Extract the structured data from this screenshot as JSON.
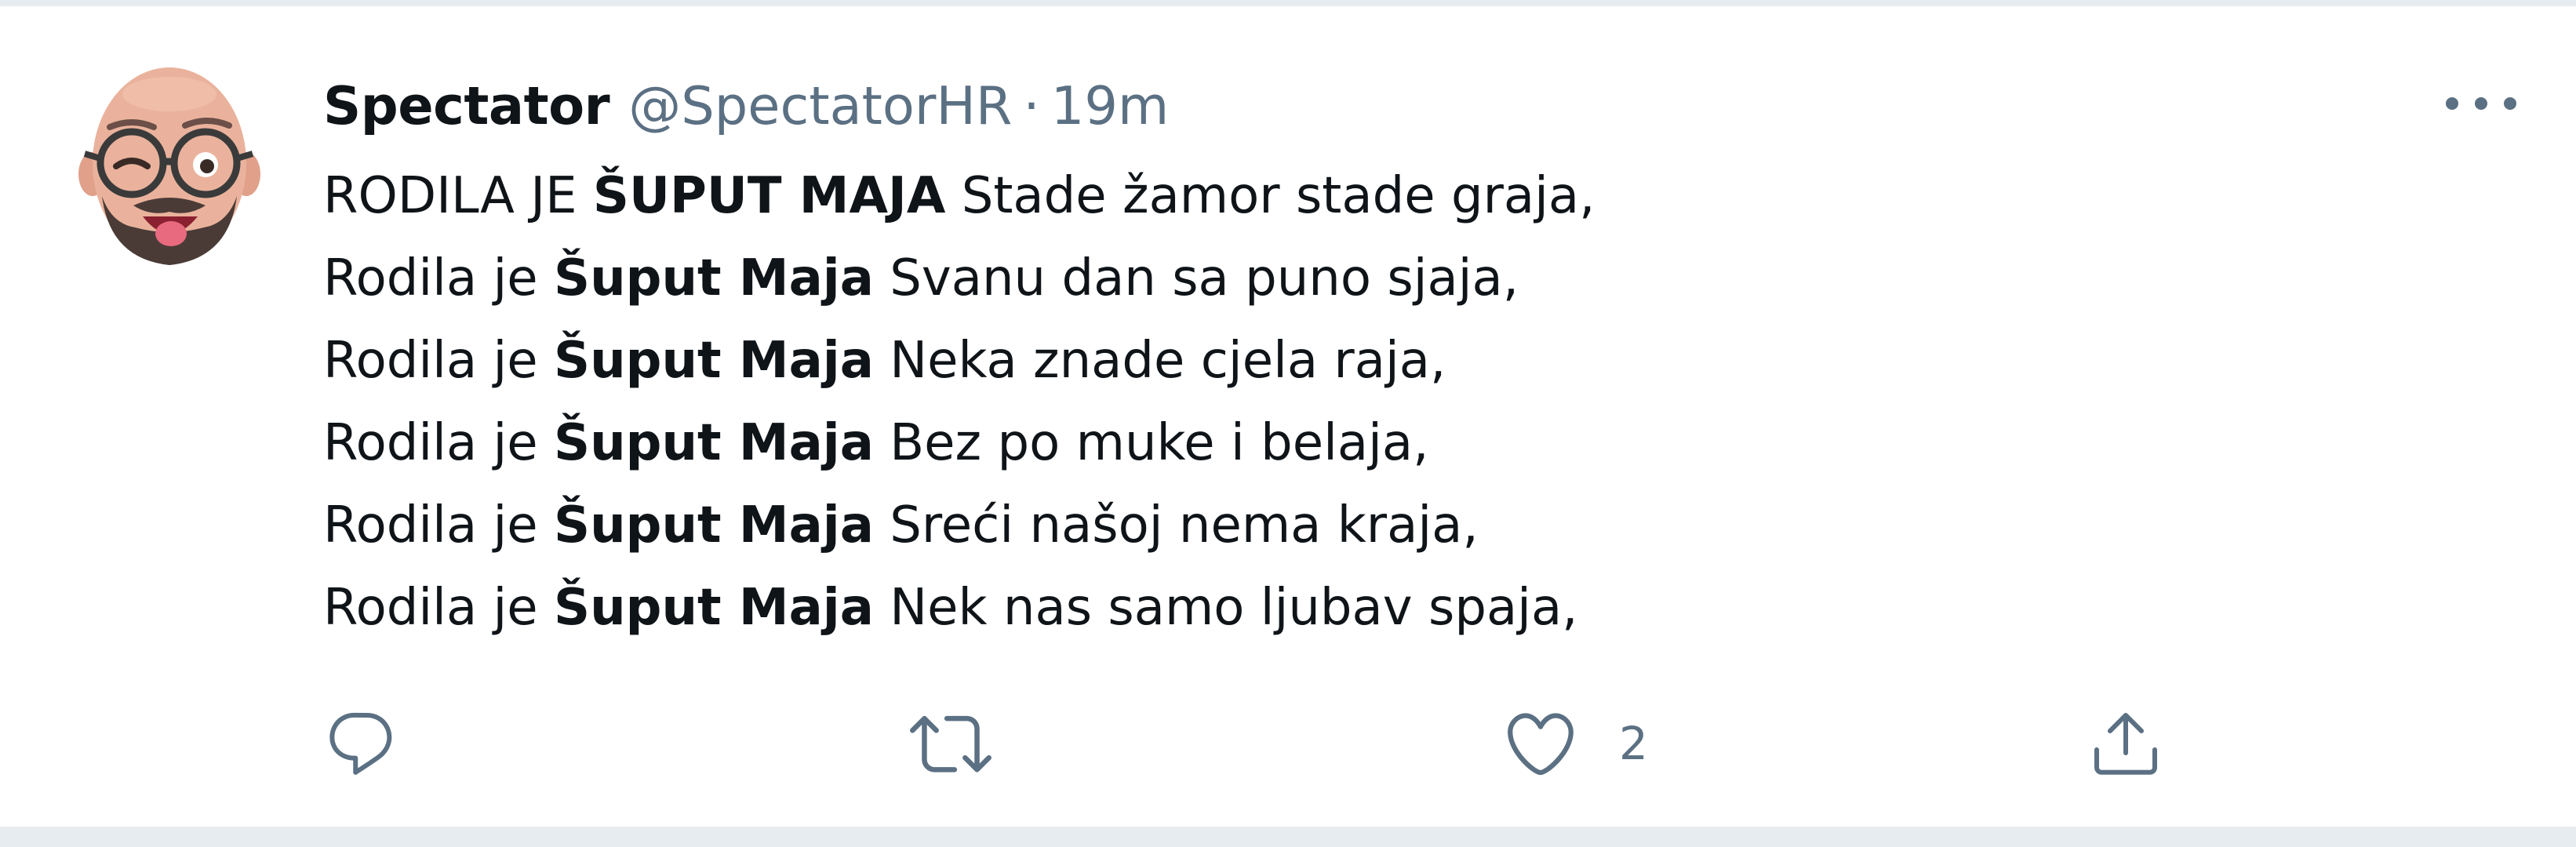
{
  "tweet": {
    "author": {
      "name": "Spectator",
      "handle": "@SpectatorHR",
      "separator": "·",
      "time": "19m"
    },
    "lines": [
      {
        "prefix": "RODILA JE ",
        "bold": "ŠUPUT MAJA",
        "suffix": " Stade žamor stade graja,"
      },
      {
        "prefix": "Rodila je ",
        "bold": "Šuput Maja",
        "suffix": " Svanu dan sa puno sjaja,"
      },
      {
        "prefix": "Rodila je ",
        "bold": "Šuput Maja",
        "suffix": " Neka znade cjela raja,"
      },
      {
        "prefix": "Rodila je ",
        "bold": "Šuput Maja",
        "suffix": " Bez po muke i belaja,"
      },
      {
        "prefix": "Rodila je ",
        "bold": "Šuput Maja",
        "suffix": " Sreći našoj nema kraja,"
      },
      {
        "prefix": "Rodila je ",
        "bold": "Šuput Maja",
        "suffix": " Nek nas samo ljubav spaja,"
      }
    ],
    "actions": {
      "reply_icon": "reply-icon",
      "retweet_icon": "retweet-icon",
      "like_icon": "heart-icon",
      "like_count": "2",
      "share_icon": "share-icon"
    },
    "colors": {
      "text": "#0f1419",
      "secondary": "#5b7083",
      "background": "#ffffff"
    }
  }
}
